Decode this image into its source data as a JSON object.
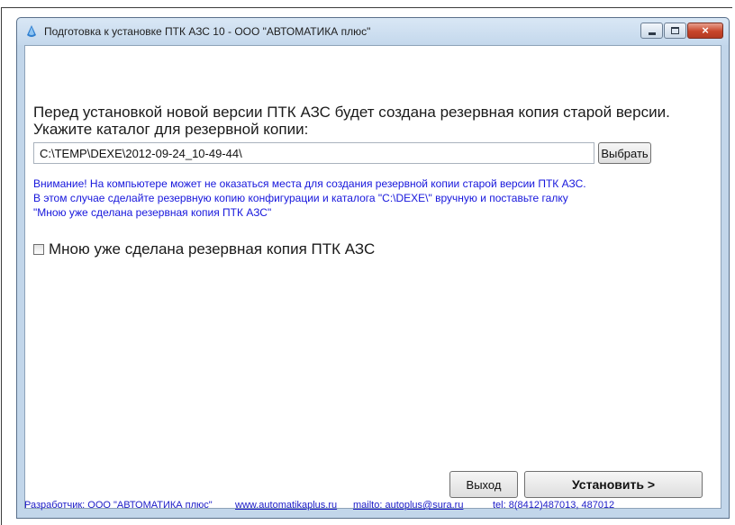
{
  "window": {
    "title": "Подготовка к установке ПТК АЗС 10 - ООО \"АВТОМАТИКА плюс\"",
    "close_glyph": "×"
  },
  "main": {
    "line1": "Перед установкой новой версии ПТК АЗС будет создана резервная копия старой версии.",
    "line2": "Укажите каталог для резервной копии:",
    "path_value": "C:\\TEMP\\DEXE\\2012-09-24_10-49-44\\",
    "choose_button": "Выбрать",
    "warning_line1": "Внимание! На компьютере может не оказаться места для создания резервной копии старой версии ПТК АЗС.",
    "warning_line2": "В этом случае сделайте резервную копию конфигурации и каталога \"C:\\DEXE\\\" вручную и поставьте галку",
    "warning_line3": "\"Мною уже сделана резервная копия ПТК АЗС\"",
    "checkbox_label": "Мною уже сделана резервная копия ПТК АЗС",
    "checkbox_checked": false
  },
  "buttons": {
    "exit": "Выход",
    "install": "Установить >"
  },
  "statusbar": {
    "developer": "Разработчик: ООО \"АВТОМАТИКА плюс\"",
    "website": "www.automatikaplus.ru",
    "email": "mailto: autoplus@sura.ru",
    "tel": "tel: 8(8412)487013, 487012"
  },
  "colors": {
    "frame": "#c2d6ea",
    "warning": "#1616dc",
    "link": "#1c1cc8"
  }
}
